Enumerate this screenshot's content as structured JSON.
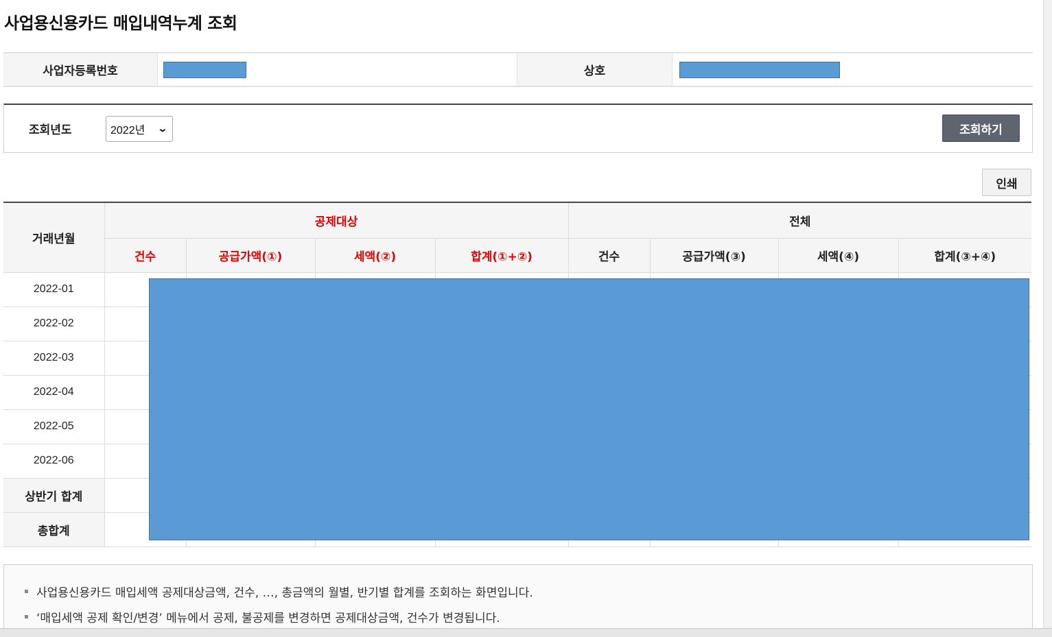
{
  "page": {
    "title": "사업용신용카드 매입내역누계 조회"
  },
  "info": {
    "biz_no_label": "사업자등록번호",
    "company_label": "상호"
  },
  "search": {
    "year_label": "조회년도",
    "year_value": "2022년",
    "search_button": "조회하기"
  },
  "print_button": "인쇄",
  "table": {
    "period_header": "거래년월",
    "group_deduct": "공제대상",
    "group_total": "전체",
    "sub_headers_deduct": [
      "건수",
      "공급가액(①)",
      "세액(②)",
      "합계(①+②)"
    ],
    "sub_headers_total": [
      "건수",
      "공급가액(③)",
      "세액(④)",
      "합계(③+④)"
    ],
    "rows": [
      {
        "label": "2022-01",
        "total": false
      },
      {
        "label": "2022-02",
        "total": false
      },
      {
        "label": "2022-03",
        "total": false
      },
      {
        "label": "2022-04",
        "total": false
      },
      {
        "label": "2022-05",
        "total": false
      },
      {
        "label": "2022-06",
        "total": false
      },
      {
        "label": "상반기 합계",
        "total": true
      },
      {
        "label": "총합계",
        "total": true
      }
    ]
  },
  "notes": [
    "사업용신용카드 매입세액 공제대상금액, 건수, …, 총금액의 월별, 반기별 합계를 조회하는 화면입니다.",
    "‘매입세액 공제 확인/변경’ 메뉴에서 공제, 불공제를 변경하면 공제대상금액, 건수가 변경됩니다."
  ],
  "colors": {
    "mask": "#5b9bd5",
    "accent_red": "#e60000",
    "button_dark": "#5f6570"
  }
}
